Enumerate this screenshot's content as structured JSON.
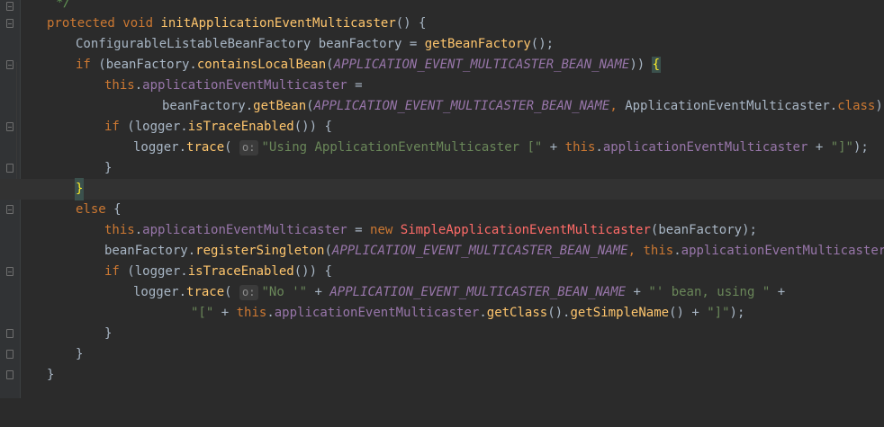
{
  "editor": {
    "comment_end": "*/",
    "lines": {
      "l1": {
        "kw1": "protected",
        "kw2": "void",
        "method": "initApplicationEventMulticaster",
        "rest": "() {"
      },
      "l2": {
        "type": "ConfigurableListableBeanFactory",
        "var": "beanFactory",
        "eq": " = ",
        "call": "getBeanFactory",
        "rest": "();"
      },
      "l3": {
        "kw": "if",
        "open": " (beanFactory.",
        "call": "containsLocalBean",
        "paren": "(",
        "const": "APPLICATION_EVENT_MULTICASTER_BEAN_NAME",
        "close": ")) ",
        "brace": "{"
      },
      "l4": {
        "kw": "this",
        "dot": ".",
        "field": "applicationEventMulticaster",
        "rest": " ="
      },
      "l5": {
        "obj": "beanFactory.",
        "call": "getBean",
        "paren": "(",
        "const": "APPLICATION_EVENT_MULTICASTER_BEAN_NAME",
        "comma": ", ",
        "cls": "ApplicationEventMulticaster",
        "dot": ".",
        "kwclass": "class",
        "rest": ");"
      },
      "l6": {
        "kw": "if",
        "open": " (logger.",
        "call": "isTraceEnabled",
        "rest": "()) {"
      },
      "l7": {
        "obj": "logger.",
        "call": "trace",
        "paren": "(",
        "hint": "o:",
        "str1": "\"Using ApplicationEventMulticaster [\"",
        "plus1": " + ",
        "kw": "this",
        "dot": ".",
        "field": "applicationEventMulticaster",
        "plus2": " + ",
        "str2": "\"]\"",
        "rest": ");"
      },
      "l8": {
        "rest": "}"
      },
      "l9": {
        "brace": "}"
      },
      "l10": {
        "kw": "else",
        "rest": " {"
      },
      "l11": {
        "kw": "this",
        "dot": ".",
        "field": "applicationEventMulticaster",
        "eq": " = ",
        "kwnew": "new",
        "cls": "SimpleApplicationEventMulticaster",
        "rest": "(beanFactory);"
      },
      "l12": {
        "obj": "beanFactory.",
        "call": "registerSingleton",
        "paren": "(",
        "const": "APPLICATION_EVENT_MULTICASTER_BEAN_NAME",
        "comma": ", ",
        "kw": "this",
        "dot": ".",
        "field": "applicationEventMulticaster",
        "rest": ");"
      },
      "l13": {
        "kw": "if",
        "open": " (logger.",
        "call": "isTraceEnabled",
        "rest": "()) {"
      },
      "l14": {
        "obj": "logger.",
        "call": "trace",
        "paren": "(",
        "hint": "o:",
        "str1": "\"No '\"",
        "plus1": " + ",
        "const": "APPLICATION_EVENT_MULTICASTER_BEAN_NAME",
        "plus2": " + ",
        "str2": "\"' bean, using \"",
        "rest": " +"
      },
      "l15": {
        "str1": "\"[\"",
        "plus1": " + ",
        "kw": "this",
        "dot": ".",
        "field": "applicationEventMulticaster",
        "dot2": ".",
        "call1": "getClass",
        "mid": "().",
        "call2": "getSimpleName",
        "plus2": "() + ",
        "str2": "\"]\"",
        "rest": ");"
      },
      "l16": {
        "rest": "}"
      },
      "l17": {
        "rest": "}"
      },
      "l18": {
        "rest": "}"
      }
    }
  }
}
